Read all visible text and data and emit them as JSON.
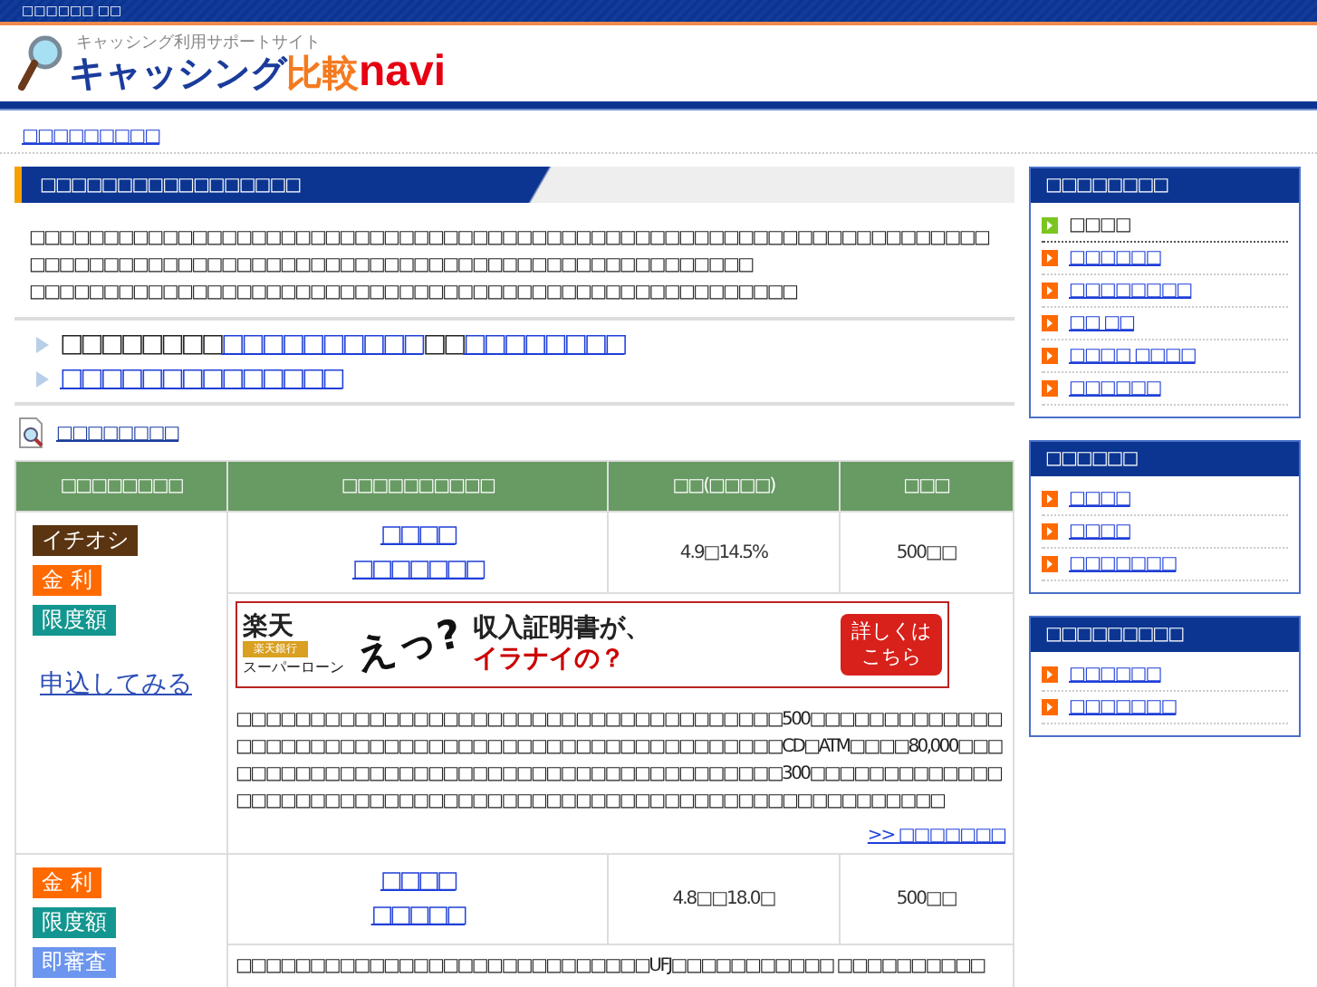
{
  "top_bar": {
    "text": "□□□□□□ □□"
  },
  "logo": {
    "tagline": "キャッシング利用サポートサイト",
    "name_main": "キャッシング",
    "name_accent": "比較",
    "name_suffix": "navi"
  },
  "breadcrumb": "□□□□□□□□□",
  "section": {
    "title": "□□□□□□□□□□□□□□□□□",
    "paragraphs": [
      "□□□□□□□□□□□□□□□□□□□□□□□□□□□□□□□□□□□□□□□□□□□□□□□□□□□□□□□□□□□□□□□□□□□□□□□□□□□□□□□□□□□□□□□□□□□□□□□□□□□□□□□□□□□□□□□□□□",
      "□□□□□□□□□□□□□□□□□□□□□□□□□□□□□□□□□□□□□□□□□□□□□□□□□□□□"
    ]
  },
  "links": [
    {
      "parts": [
        {
          "kind": "text",
          "text": "□□□□□□□□"
        },
        {
          "kind": "link",
          "text": "□□□□□□□□□□"
        },
        {
          "kind": "text",
          "text": "□□"
        },
        {
          "kind": "link",
          "text": "□□□□□□□□"
        }
      ]
    },
    {
      "parts": [
        {
          "kind": "link",
          "text": "□□□□□□□□□□□□□□"
        }
      ]
    }
  ],
  "results_link": "□□□□□□□□",
  "table": {
    "columns": [
      "□□□□□□□□",
      "□□□□□□□□□□",
      "□□(□□□□)",
      "□□□"
    ],
    "rows": [
      {
        "badges": [
          {
            "kind": "pick",
            "text": "イチオシ"
          },
          {
            "kind": "rate",
            "text": "金 利"
          },
          {
            "kind": "limit",
            "text": "限度額"
          }
        ],
        "apply": "申込してみる",
        "name": [
          "□□□□",
          "□□□□□□□"
        ],
        "rate": "4.9□14.5%",
        "limit": "500□□",
        "banner": {
          "bank": "楽天",
          "bank_sub": "楽天銀行",
          "product": "スーパーローン",
          "exclaim": "えっ?",
          "line1": "収入証明書が、",
          "line2": "イラナイの？",
          "cta": "詳しくはこちら"
        },
        "description": "□□□□□□□□□□□□□□□□□□□□□□□□□□□□□□□□□□□□□500□□□□□□□□□□□□□□□□□□□□□□□□□□□□□□□□□□□□□□□□□□□□□□□□□□CD□ATM□□□□80,000□□□□□□□□□□□□□□□□□□□□□□□□□□□□□□□□□□□□□□□□300□□□□□□□□□□□□□□□□□□□□□□□□□□□□□□□□□□□□□□□□□□□□□□□□□□□□□□□□□□□□□",
        "more": ">> □□□□□□□"
      },
      {
        "badges": [
          {
            "kind": "rate",
            "text": "金 利"
          },
          {
            "kind": "limit",
            "text": "限度額"
          },
          {
            "kind": "quick",
            "text": "即審査"
          }
        ],
        "name": [
          "□□□□",
          "□□□□□"
        ],
        "rate": "4.8□□18.0□",
        "limit": "500□□",
        "description": "□□□□□□□□□□□□□□□□□□□□□□□□□□□□UFJ□□□□□□□□□□□ □□□□□□□□□□"
      }
    ]
  },
  "sidebar": [
    {
      "title": "□□□□□□□□",
      "items": [
        {
          "label": "□□□□",
          "selected": true
        },
        {
          "label": "□□□□□□",
          "selected": false
        },
        {
          "label": "□□□□□□□□",
          "selected": false
        },
        {
          "label": "□□ □□",
          "selected": false
        },
        {
          "label": "□□□□ □□□□",
          "selected": false
        },
        {
          "label": "□□□□□□",
          "selected": false
        }
      ]
    },
    {
      "title": "□□□□□□",
      "items": [
        {
          "label": "□□□□",
          "selected": false
        },
        {
          "label": "□□□□",
          "selected": false
        },
        {
          "label": "□□□□□□□",
          "selected": false
        }
      ]
    },
    {
      "title": "□□□□□□□□□",
      "items": [
        {
          "label": "□□□□□□",
          "selected": false
        },
        {
          "label": "□□□□□□□",
          "selected": false
        }
      ]
    }
  ]
}
